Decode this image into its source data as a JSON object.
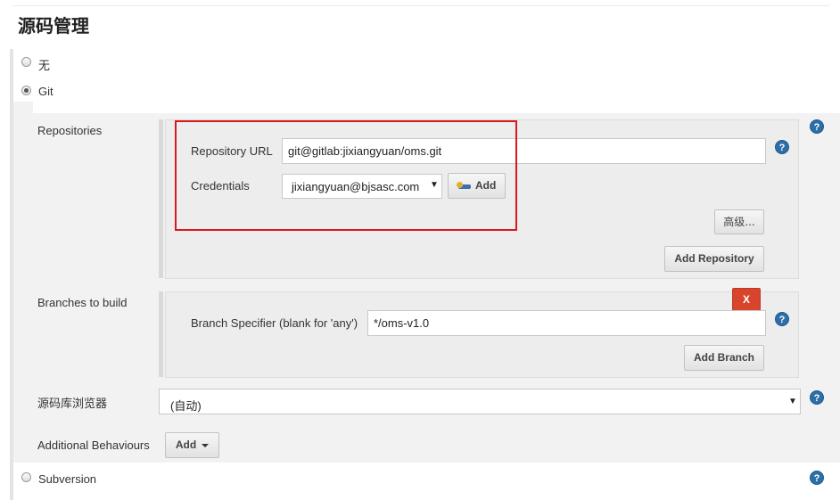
{
  "section": {
    "title": "源码管理"
  },
  "scm_options": {
    "none_label": "无",
    "git_label": "Git",
    "subversion_label": "Subversion"
  },
  "repositories": {
    "label": "Repositories",
    "url_label": "Repository URL",
    "url_value": "git@gitlab:jixiangyuan/oms.git",
    "credentials_label": "Credentials",
    "credentials_value": "jixiangyuan@bjsasc.com",
    "add_credentials_label": "Add",
    "advanced_label": "高级...",
    "add_repository_label": "Add Repository"
  },
  "branches": {
    "label": "Branches to build",
    "delete_label": "X",
    "specifier_label": "Branch Specifier (blank for 'any')",
    "specifier_value": "*/oms-v1.0",
    "add_branch_label": "Add Branch"
  },
  "browser": {
    "label": "源码库浏览器",
    "value": "(自动)"
  },
  "behaviours": {
    "label": "Additional Behaviours",
    "add_label": "Add"
  },
  "help": {
    "glyph": "?"
  },
  "colors": {
    "highlight_box": "#d9191c",
    "help_icon": "#2d6ea8",
    "delete_button": "#d9442c"
  }
}
